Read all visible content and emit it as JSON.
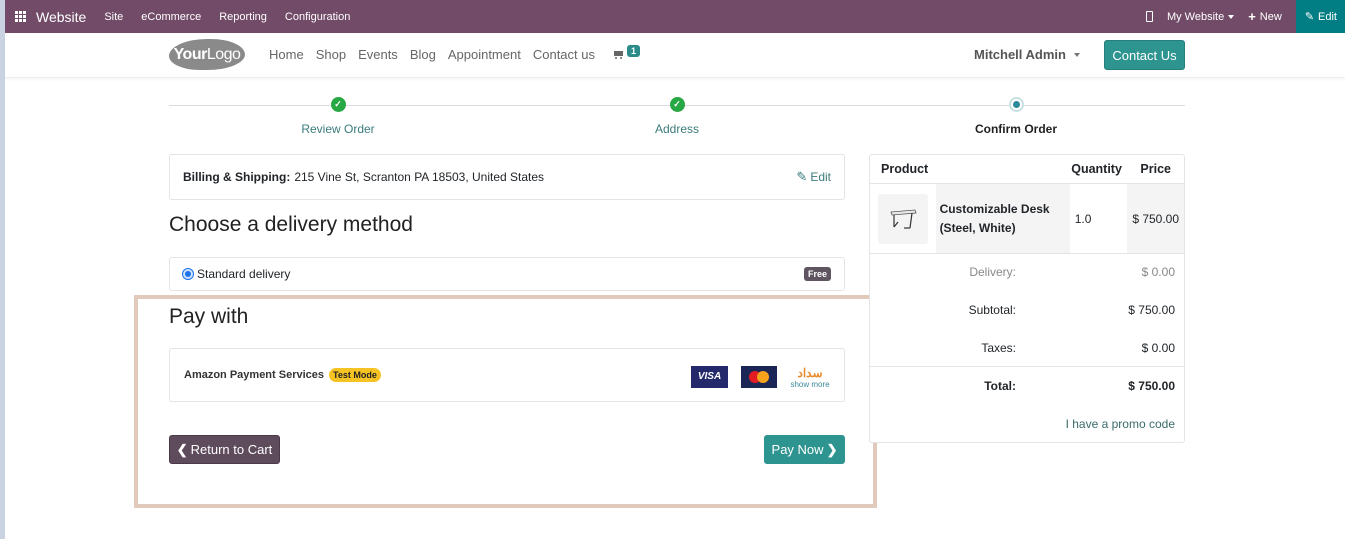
{
  "topbar": {
    "app_name": "Website",
    "menus": [
      "Site",
      "eCommerce",
      "Reporting",
      "Configuration"
    ],
    "website_selector": "My Website",
    "new_label": "New",
    "edit_label": "Edit"
  },
  "header": {
    "logo_text_bold": "Your",
    "logo_text": "Logo",
    "nav": [
      "Home",
      "Shop",
      "Events",
      "Blog",
      "Appointment",
      "Contact us"
    ],
    "cart_count": "1",
    "user": "Mitchell Admin",
    "contact_button": "Contact Us"
  },
  "steps": [
    {
      "label": "Review Order",
      "state": "done"
    },
    {
      "label": "Address",
      "state": "done"
    },
    {
      "label": "Confirm Order",
      "state": "current"
    }
  ],
  "billing": {
    "label": "Billing & Shipping:",
    "address": "215 Vine St, Scranton PA 18503, United States",
    "edit": "Edit"
  },
  "delivery": {
    "heading": "Choose a delivery method",
    "method": "Standard delivery",
    "badge": "Free"
  },
  "payment": {
    "heading": "Pay with",
    "provider": "Amazon Payment Services",
    "mode_badge": "Test Mode",
    "icons": [
      "visa",
      "mastercard",
      "sadad"
    ],
    "visa_text": "VISA",
    "sadad_text": "سداد",
    "show_more": "show more",
    "return_button": "Return to Cart",
    "pay_button": "Pay Now"
  },
  "summary": {
    "headers": {
      "product": "Product",
      "quantity": "Quantity",
      "price": "Price"
    },
    "items": [
      {
        "name_line1": "Customizable Desk",
        "name_line2": "(Steel, White)",
        "quantity": "1.0",
        "price": "$ 750.00"
      }
    ],
    "delivery_label": "Delivery:",
    "delivery_value": "$ 0.00",
    "subtotal_label": "Subtotal:",
    "subtotal_value": "$ 750.00",
    "taxes_label": "Taxes:",
    "taxes_value": "$ 0.00",
    "total_label": "Total:",
    "total_value": "$ 750.00",
    "promo": "I have a promo code"
  },
  "colors": {
    "topbar": "#714b67",
    "edit_bg": "#017e84",
    "primary": "#2e9490",
    "secondary": "#5e4b5c",
    "highlight_border": "#e1c9bc",
    "done_step": "#28a745"
  }
}
